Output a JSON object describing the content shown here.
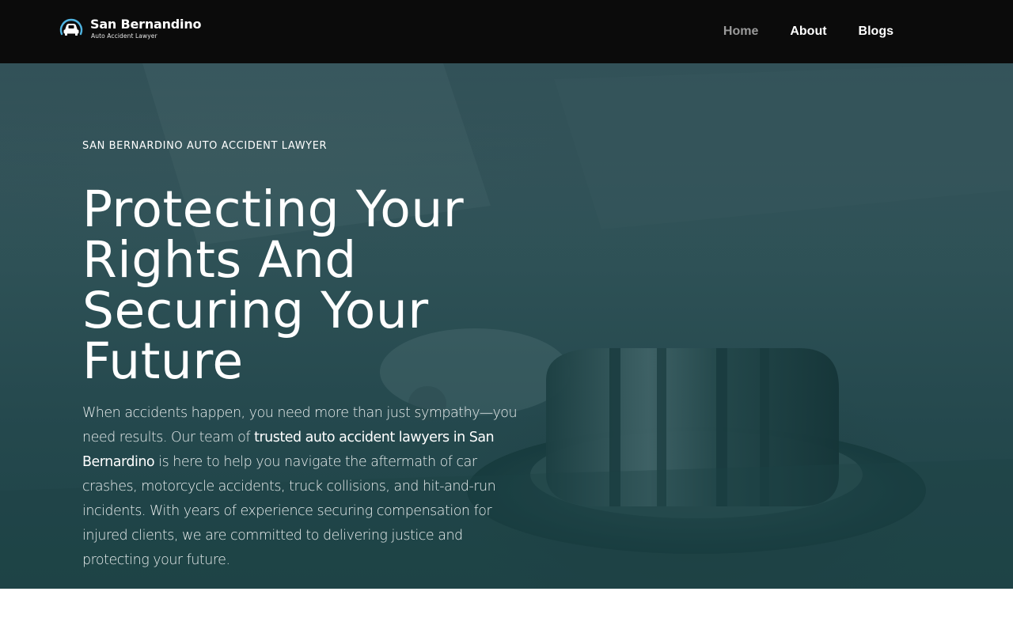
{
  "header": {
    "logo": {
      "title": "San Bernandino",
      "subtitle": "Auto Accident Lawyer"
    },
    "nav": [
      {
        "label": "Home",
        "active": true
      },
      {
        "label": "About",
        "active": false
      },
      {
        "label": "Blogs",
        "active": false
      }
    ]
  },
  "hero": {
    "eyebrow": "SAN BERNARDINO AUTO ACCIDENT LAWYER",
    "headline": "Protecting Your Rights And Securing Your Future",
    "lead": {
      "before": "When accidents happen, you need more than just sympathy—you need results. Our team of ",
      "highlight": "trusted auto accident lawyers in San Bernardino",
      "after": " is here to help you navigate the aftermath of car crashes, motorcycle accidents, truck collisions, and hit-and-run incidents. With years of experience securing compensation for injured clients, we are committed to delivering justice and protecting your future."
    }
  },
  "colors": {
    "header_bg": "#0b0b0b",
    "nav_active": "#9a9a9a",
    "hero_overlay": "#24484d",
    "logo_accent": "#4fb3e0"
  },
  "icons": {
    "logo_mark": "car-in-circle-icon"
  }
}
